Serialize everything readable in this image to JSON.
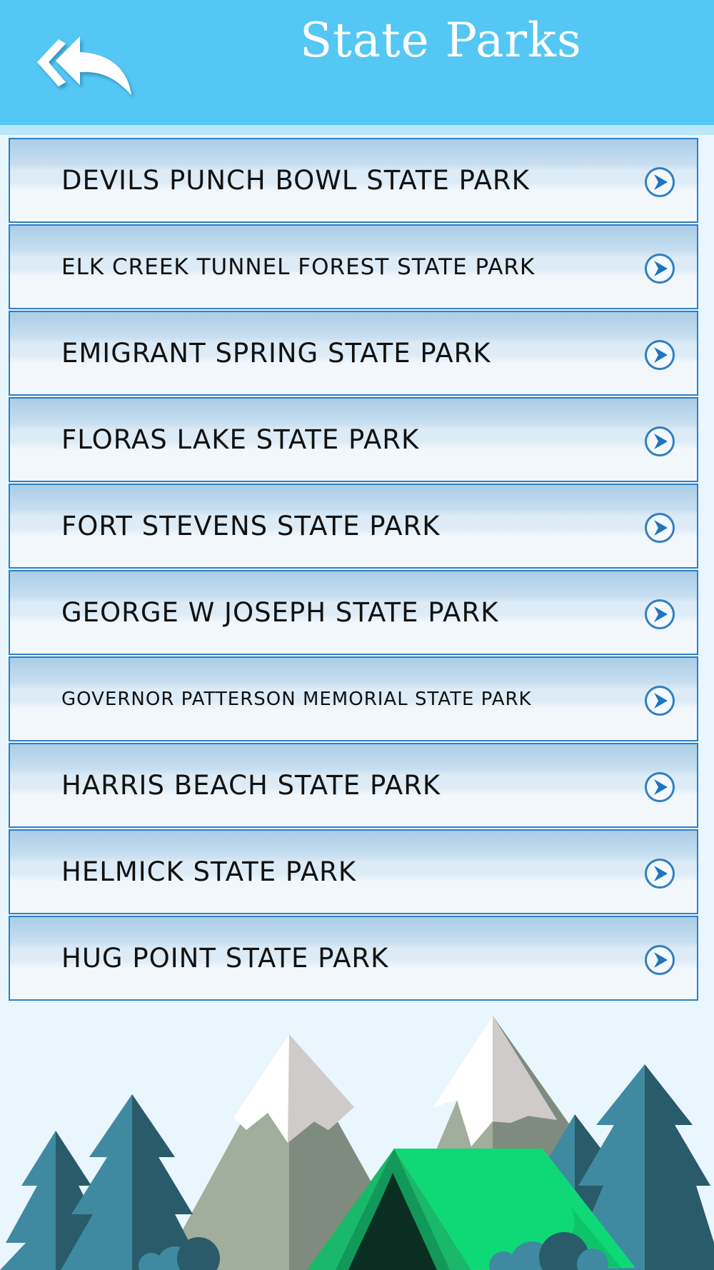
{
  "header": {
    "title": "State Parks",
    "back_icon": "double-back-arrow-icon",
    "background_color": "#54c7f4"
  },
  "parks": [
    {
      "label": "DEVILS PUNCH BOWL STATE PARK",
      "font_size": "37px"
    },
    {
      "label": "ELK CREEK TUNNEL FOREST STATE PARK",
      "font_size": "31px"
    },
    {
      "label": "EMIGRANT SPRING STATE PARK",
      "font_size": "37px"
    },
    {
      "label": "FLORAS LAKE STATE PARK",
      "font_size": "37px"
    },
    {
      "label": "FORT STEVENS STATE PARK",
      "font_size": "37px"
    },
    {
      "label": "GEORGE W JOSEPH STATE PARK",
      "font_size": "37px"
    },
    {
      "label": "GOVERNOR PATTERSON MEMORIAL STATE PARK",
      "font_size": "26px"
    },
    {
      "label": "HARRIS BEACH STATE PARK",
      "font_size": "37px"
    },
    {
      "label": "HELMICK STATE PARK",
      "font_size": "37px"
    },
    {
      "label": "HUG POINT STATE PARK",
      "font_size": "37px"
    }
  ],
  "row_icon": "chevron-right-circle-icon",
  "accent_color": "#2f7fc4"
}
